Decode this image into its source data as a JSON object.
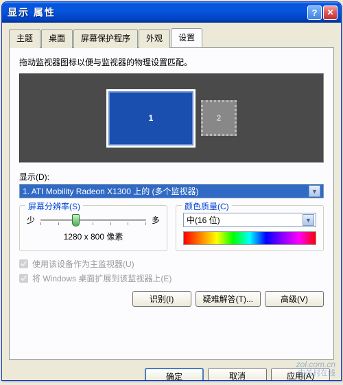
{
  "window": {
    "title": "显示 属性"
  },
  "tabs": {
    "items": [
      {
        "label": "主题"
      },
      {
        "label": "桌面"
      },
      {
        "label": "屏幕保护程序"
      },
      {
        "label": "外观"
      },
      {
        "label": "设置"
      }
    ],
    "active_index": 4
  },
  "instruction": "拖动监视器图标以便与监视器的物理设置匹配。",
  "monitors": {
    "primary": "1",
    "secondary": "2"
  },
  "display_label": "显示(D):",
  "display_value": "1. ATI Mobility Radeon X1300 上的 (多个监视器)",
  "resolution": {
    "group_title": "屏幕分辨率(S)",
    "less": "少",
    "more": "多",
    "value": "1280 x 800 像素"
  },
  "color_quality": {
    "group_title": "颜色质量(C)",
    "value": "中(16 位)"
  },
  "checkboxes": {
    "primary": "使用该设备作为主监视器(U)",
    "extend": "将 Windows 桌面扩展到该监视器上(E)"
  },
  "buttons": {
    "identify": "识别(I)",
    "troubleshoot": "疑难解答(T)...",
    "advanced": "高级(V)",
    "ok": "确定",
    "cancel": "取消",
    "apply": "应用(A)"
  },
  "watermark": {
    "line1": "zol.com.cn",
    "line2": "中关村在线"
  }
}
